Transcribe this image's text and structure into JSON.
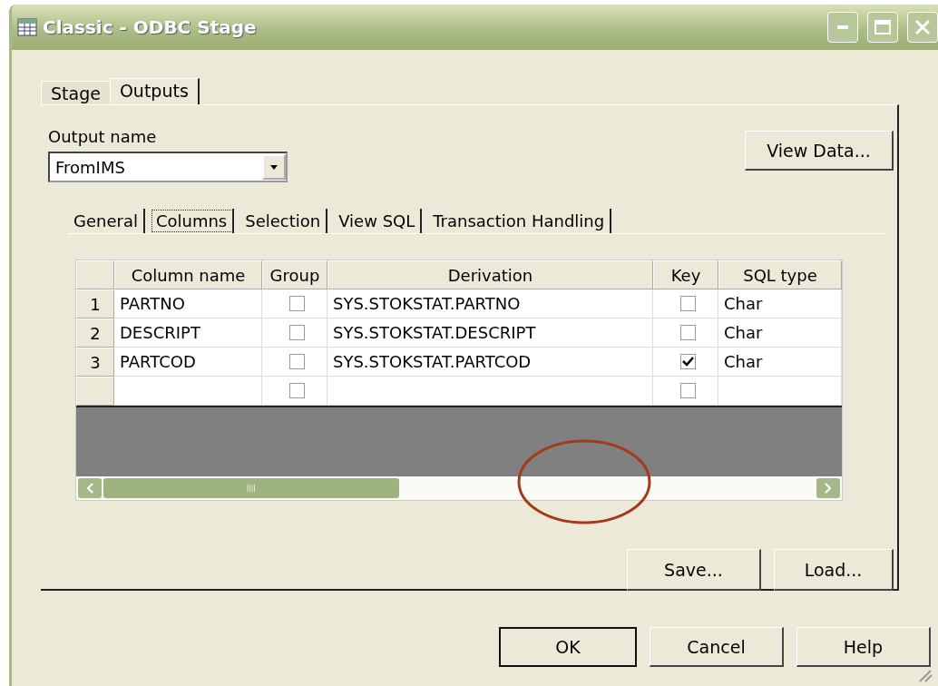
{
  "window": {
    "title": "Classic - ODBC Stage"
  },
  "tabs": [
    {
      "label": "Stage",
      "selected": false
    },
    {
      "label": "Outputs",
      "selected": true
    }
  ],
  "output_name": {
    "label": "Output name",
    "value": "FromIMS"
  },
  "view_data_button": "View Data...",
  "sub_tabs": [
    {
      "label": "General",
      "selected": false
    },
    {
      "label": "Columns",
      "selected": true
    },
    {
      "label": "Selection",
      "selected": false
    },
    {
      "label": "View SQL",
      "selected": false
    },
    {
      "label": "Transaction Handling",
      "selected": false
    }
  ],
  "grid": {
    "columns": [
      "Column name",
      "Group",
      "Derivation",
      "Key",
      "SQL type"
    ],
    "rows": [
      {
        "number": "1",
        "column_name": "PARTNO",
        "group": false,
        "derivation": "SYS.STOKSTAT.PARTNO",
        "key": false,
        "sql_type": "Char"
      },
      {
        "number": "2",
        "column_name": "DESCRIPT",
        "group": false,
        "derivation": "SYS.STOKSTAT.DESCRIPT",
        "key": false,
        "sql_type": "Char"
      },
      {
        "number": "3",
        "column_name": "PARTCOD",
        "group": false,
        "derivation": "SYS.STOKSTAT.PARTCOD",
        "key": true,
        "sql_type": "Char"
      },
      {
        "group": false,
        "key": false
      }
    ]
  },
  "panel_buttons": [
    "Save...",
    "Load..."
  ],
  "buttons": [
    {
      "label": "OK",
      "default": true
    },
    {
      "label": "Cancel",
      "default": false
    },
    {
      "label": "Help",
      "default": false
    }
  ]
}
